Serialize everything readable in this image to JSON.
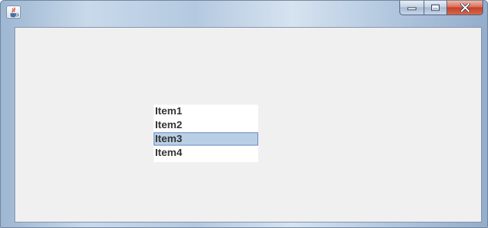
{
  "window": {
    "icon": "java-cup-icon",
    "controls": {
      "minimize_icon": "minimize-icon",
      "maximize_icon": "maximize-icon",
      "close_icon": "close-icon"
    }
  },
  "list": {
    "items": [
      {
        "label": "Item1",
        "selected": false
      },
      {
        "label": "Item2",
        "selected": false
      },
      {
        "label": "Item3",
        "selected": true
      },
      {
        "label": "Item4",
        "selected": false
      }
    ],
    "selection_color": "#b8cfe5",
    "selection_border": "#6382bf"
  }
}
